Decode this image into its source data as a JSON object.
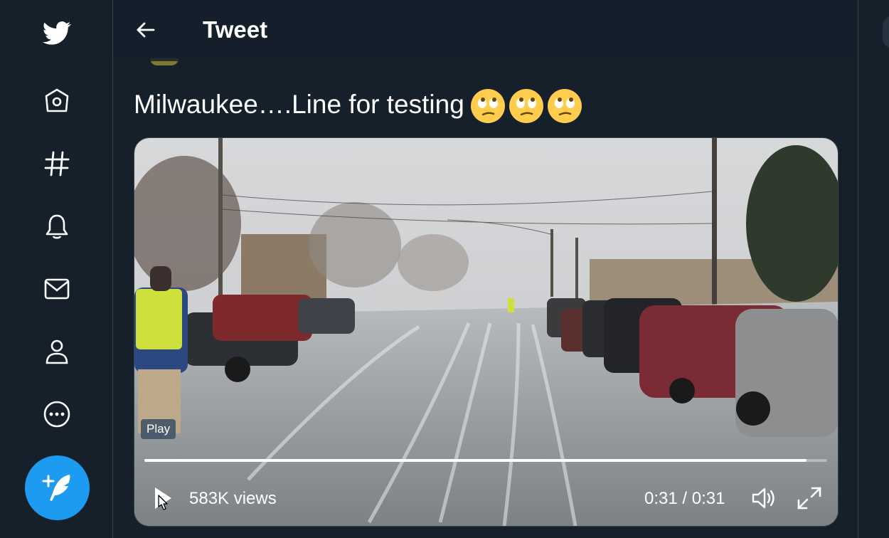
{
  "header": {
    "title": "Tweet"
  },
  "nav": {
    "items": [
      {
        "icon": "home-icon"
      },
      {
        "icon": "hashtag-icon"
      },
      {
        "icon": "bell-icon"
      },
      {
        "icon": "mail-icon"
      },
      {
        "icon": "profile-icon"
      },
      {
        "icon": "more-icon"
      }
    ],
    "compose_icon": "compose-tweet-icon"
  },
  "tweet": {
    "text": "Milwaukee….Line for testing",
    "emojis": [
      "face-with-rolling-eyes",
      "face-with-rolling-eyes",
      "face-with-rolling-eyes"
    ]
  },
  "video": {
    "tooltip": "Play",
    "views": "583K views",
    "time": "0:31 / 0:31",
    "progress": 0.97
  },
  "colors": {
    "background": "#15202b",
    "accent": "#1d9bf0",
    "divider": "#38444d"
  }
}
